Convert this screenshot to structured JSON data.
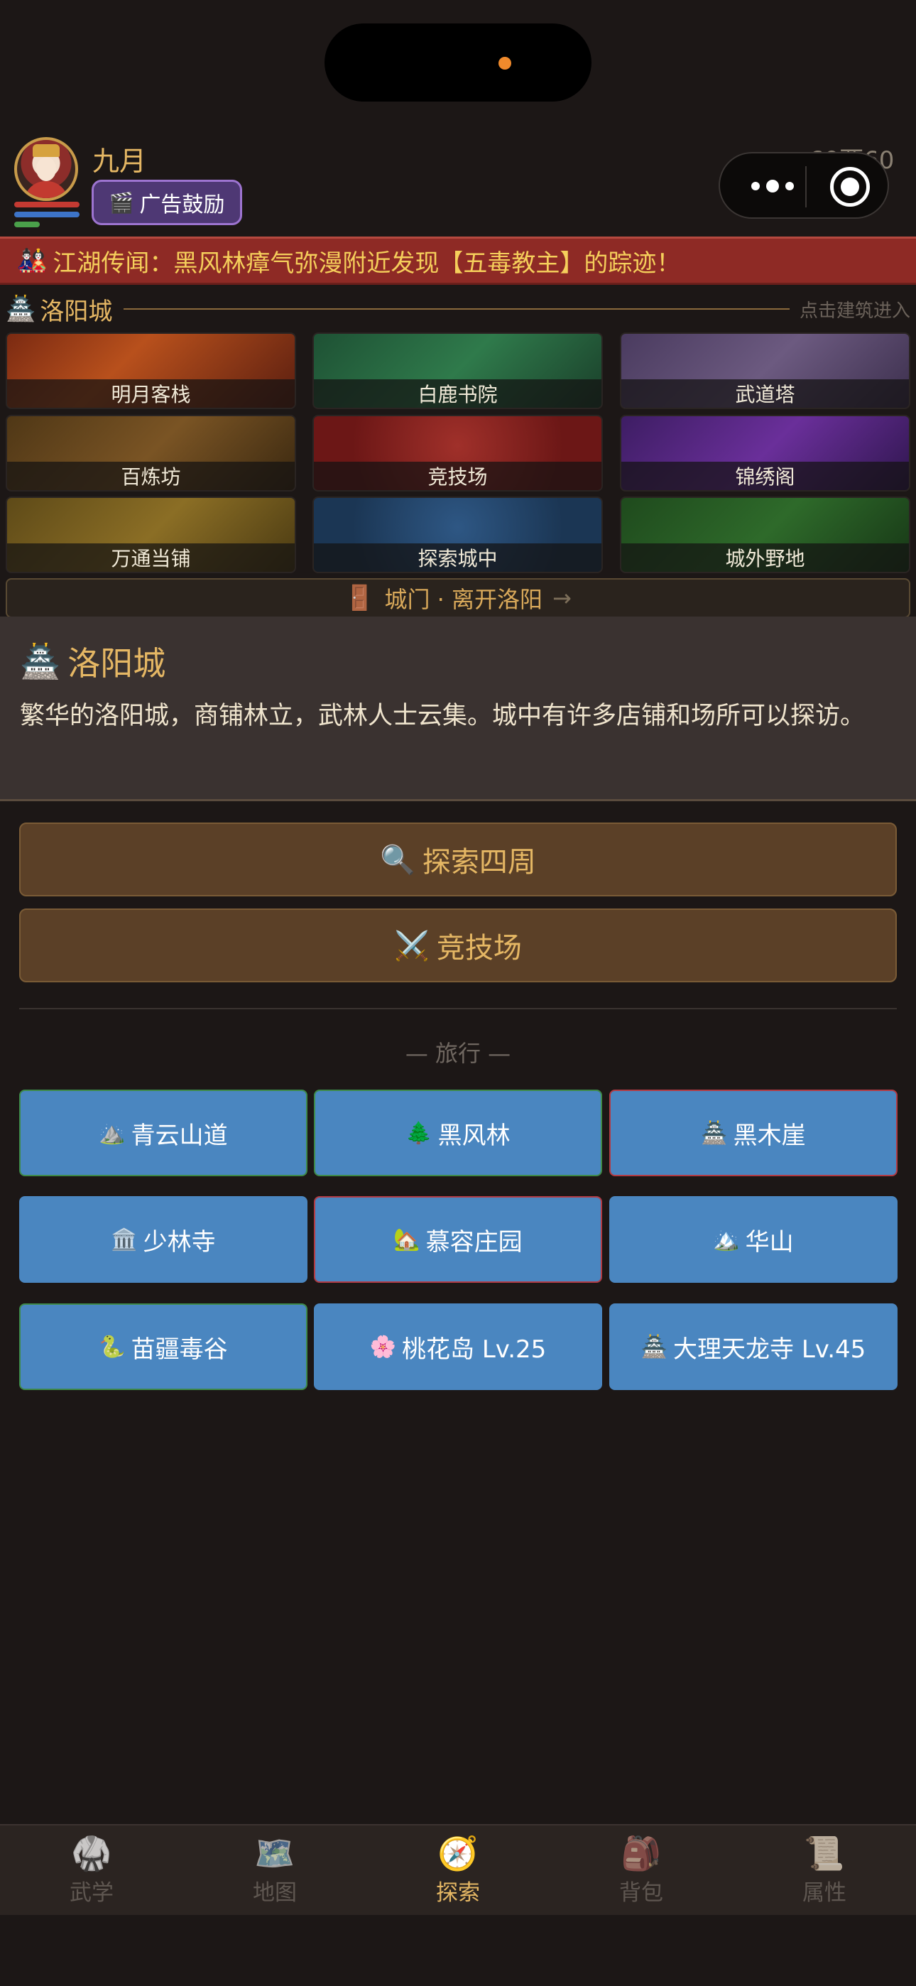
{
  "header": {
    "player_name": "九月",
    "ad_button": "广告鼓励",
    "ad_icon": "🎬",
    "money_icon": "💰",
    "money": "60两60文"
  },
  "news": {
    "icon": "🎎",
    "text": "江湖传闻：黑风林瘴气弥漫附近发现【五毒教主】的踪迹！"
  },
  "city": {
    "icon": "🏯",
    "name": "洛阳城",
    "hint": "点击建筑进入",
    "buildings": [
      "明月客栈",
      "白鹿书院",
      "武道塔",
      "百炼坊",
      "竞技场",
      "锦绣阁",
      "万通当铺",
      "探索城中",
      "城外野地"
    ],
    "gate_icon": "🚪",
    "gate": "城门 · 离开洛阳",
    "gate_arrow": "→"
  },
  "description": {
    "icon": "🏯",
    "title": "洛阳城",
    "text": "繁华的洛阳城，商铺林立，武林人士云集。城中有许多店铺和场所可以探访。"
  },
  "actions": {
    "explore_icon": "🔍",
    "explore": "探索四周",
    "arena_icon": "⚔️",
    "arena": "竞技场"
  },
  "travel": {
    "title": "— 旅行 —",
    "destinations": [
      {
        "icon": "⛰️",
        "label": "青云山道"
      },
      {
        "icon": "🌲",
        "label": "黑风林"
      },
      {
        "icon": "🏯",
        "label": "黑木崖"
      },
      {
        "icon": "🏛️",
        "label": "少林寺"
      },
      {
        "icon": "🏡",
        "label": "慕容庄园"
      },
      {
        "icon": "🏔️",
        "label": "华山"
      },
      {
        "icon": "🐍",
        "label": "苗疆毒谷"
      },
      {
        "icon": "🌸",
        "label": "桃花岛 Lv.25"
      },
      {
        "icon": "🏯",
        "label": "大理天龙寺 Lv.45"
      }
    ]
  },
  "nav": [
    {
      "icon": "🥋",
      "label": "武学"
    },
    {
      "icon": "🗺️",
      "label": "地图"
    },
    {
      "icon": "🧭",
      "label": "探索",
      "active": true
    },
    {
      "icon": "🎒",
      "label": "背包"
    },
    {
      "icon": "📜",
      "label": "属性"
    }
  ],
  "colors": {
    "background": "#1c1716",
    "accent_gold": "#e5b764",
    "news_red": "#8e2a25",
    "destination_blue": "#4a86c0",
    "action_brown": "#5b4027"
  }
}
